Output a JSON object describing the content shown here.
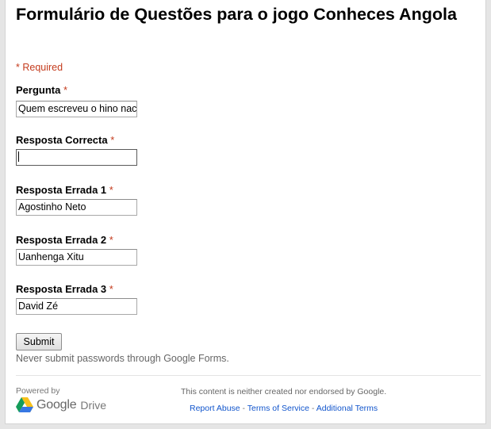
{
  "form": {
    "title": "Formulário de Questões para o jogo Conheces Angola",
    "required_note": "* Required",
    "required_mark": "*",
    "fields": [
      {
        "label": "Pergunta",
        "value": "Quem escreveu o hino nac"
      },
      {
        "label": "Resposta Correcta",
        "value": ""
      },
      {
        "label": "Resposta Errada 1",
        "value": "Agostinho Neto"
      },
      {
        "label": "Resposta Errada 2",
        "value": "Uanhenga Xitu"
      },
      {
        "label": "Resposta Errada 3",
        "value": "David Zé"
      }
    ],
    "submit_label": "Submit",
    "password_warning": "Never submit passwords through Google Forms."
  },
  "footer": {
    "powered_by": "Powered by",
    "logo_google": "Google",
    "logo_drive": "Drive",
    "disclaimer": "This content is neither created nor endorsed by Google.",
    "links": [
      "Report Abuse",
      "Terms of Service",
      "Additional Terms"
    ],
    "separator": " - ",
    "link_color": "#1155cc"
  },
  "colors": {
    "required": "#c43b1d",
    "background": "#e5e5e5"
  }
}
